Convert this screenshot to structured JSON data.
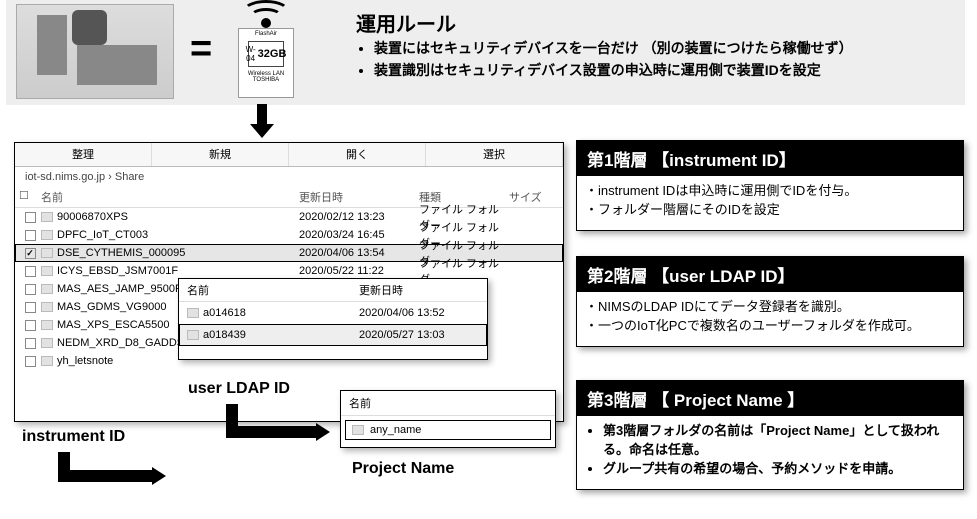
{
  "banner": {
    "rules_title": "運用ルール",
    "rules": [
      "装置にはセキュリティデバイスを一台だけ （別の装置につけたら稼働せず）",
      "装置識別はセキュリティデバイス設置の申込時に運用側で装置IDを設定"
    ],
    "sdcard": {
      "brand_top": "FlashAir",
      "capacity": "32GB",
      "spec": "W-04",
      "lan": "Wireless LAN",
      "brand_bottom": "TOSHIBA"
    }
  },
  "explorer": {
    "tabs": [
      "整理",
      "新規",
      "開く",
      "選択"
    ],
    "path": "iot-sd.nims.go.jp › Share",
    "cols": {
      "name": "名前",
      "date": "更新日時",
      "type": "種類",
      "size": "サイズ"
    },
    "rows": [
      {
        "name": "90006870XPS",
        "date": "2020/02/12 13:23",
        "type": "ファイル フォルダー",
        "checked": false,
        "hl": false,
        "boxed": false
      },
      {
        "name": "DPFC_IoT_CT003",
        "date": "2020/03/24 16:45",
        "type": "ファイル フォルダー",
        "checked": false,
        "hl": false,
        "boxed": false
      },
      {
        "name": "DSE_CYTHEMIS_000095",
        "date": "2020/04/06 13:54",
        "type": "ファイル フォルダー",
        "checked": true,
        "hl": true,
        "boxed": true
      },
      {
        "name": "ICYS_EBSD_JSM7001F",
        "date": "2020/05/22 11:22",
        "type": "ファイル フォルダー",
        "checked": false,
        "hl": false,
        "boxed": false
      },
      {
        "name": "MAS_AES_JAMP_9500F",
        "date": "",
        "type": "",
        "checked": false,
        "hl": false,
        "boxed": false
      },
      {
        "name": "MAS_GDMS_VG9000",
        "date": "",
        "type": "",
        "checked": false,
        "hl": false,
        "boxed": false
      },
      {
        "name": "MAS_XPS_ESCA5500",
        "date": "",
        "type": "",
        "checked": false,
        "hl": false,
        "boxed": false
      },
      {
        "name": "NEDM_XRD_D8_GADDS",
        "date": "",
        "type": "",
        "checked": false,
        "hl": false,
        "boxed": false
      },
      {
        "name": "yh_letsnote",
        "date": "",
        "type": "",
        "checked": false,
        "hl": false,
        "boxed": false
      }
    ]
  },
  "sub1": {
    "cols": {
      "name": "名前",
      "date": "更新日時"
    },
    "rows": [
      {
        "name": "a014618",
        "date": "2020/04/06 13:52",
        "boxed": false,
        "hl": false
      },
      {
        "name": "a018439",
        "date": "2020/05/27 13:03",
        "boxed": true,
        "hl": true
      }
    ]
  },
  "sub2": {
    "col": "名前",
    "row": "any_name"
  },
  "labels": {
    "l1": "instrument ID",
    "l2": "user LDAP ID",
    "l3": "Project Name"
  },
  "info": {
    "t1": {
      "title": "第1階層 【instrument ID】",
      "items": [
        "instrument IDは申込時に運用側でIDを付与。",
        "フォルダー階層にそのIDを設定"
      ]
    },
    "t2": {
      "title": "第2階層 【user LDAP ID】",
      "items": [
        "NIMSのLDAP IDにてデータ登録者を識別。",
        "一つのIoT化PCで複数名のユーザーフォルダを作成可。"
      ]
    },
    "t3": {
      "title": "第3階層 【 Project Name 】",
      "items": [
        "第3階層フォルダの名前は「Project Name」として扱われる。命名は任意。",
        "グループ共有の希望の場合、予約メソッドを申請。"
      ]
    }
  }
}
